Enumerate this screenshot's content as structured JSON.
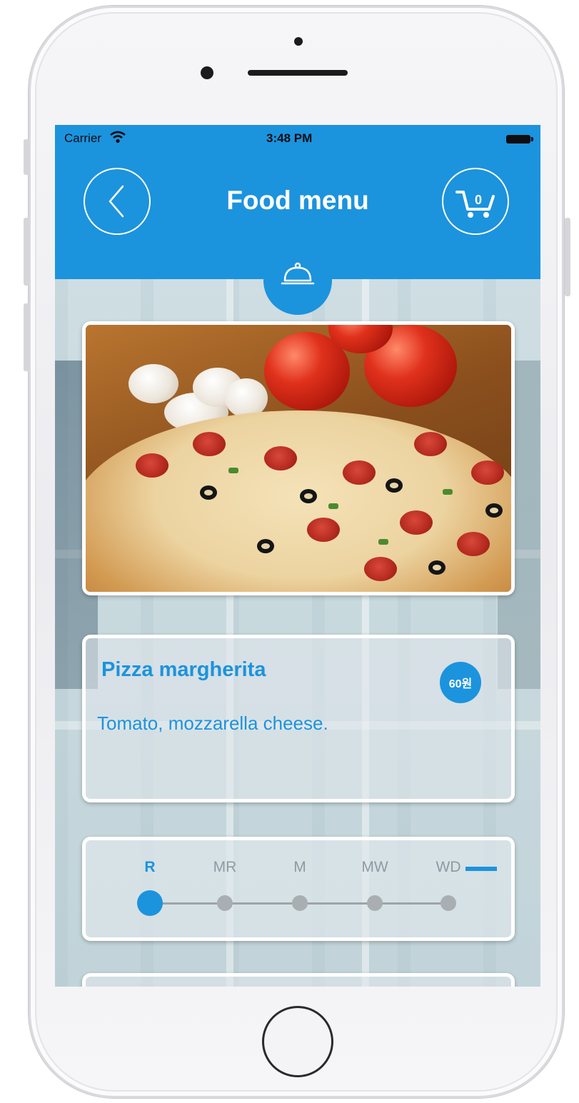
{
  "status_bar": {
    "carrier": "Carrier",
    "time": "3:48 PM"
  },
  "nav": {
    "title": "Food menu",
    "cart_count": "0"
  },
  "colors": {
    "accent": "#1c93dd",
    "white": "#ffffff"
  },
  "icons": {
    "back": "back-arrow-icon",
    "cart": "cart-icon",
    "tab": "cloche-icon",
    "wifi": "wifi-icon",
    "battery": "battery-icon"
  },
  "dish": {
    "name": "Pizza margherita",
    "description": "Tomato, mozzarella cheese.",
    "price": "60원"
  },
  "doneness": {
    "levels": [
      "R",
      "MR",
      "M",
      "MW",
      "WD"
    ],
    "selected": "R"
  }
}
